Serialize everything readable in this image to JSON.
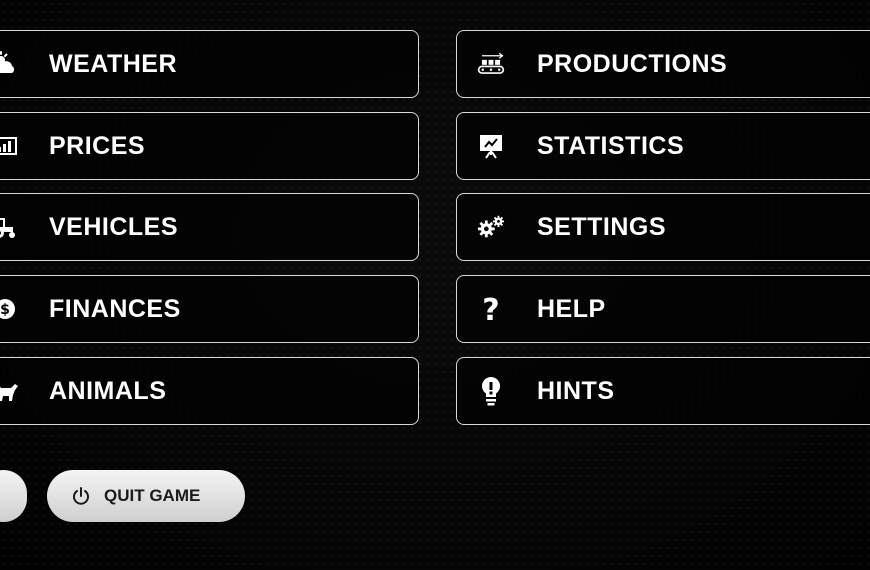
{
  "menu": {
    "left": [
      {
        "label": "WEATHER",
        "icon": "weather-icon"
      },
      {
        "label": "PRICES",
        "icon": "prices-icon"
      },
      {
        "label": "VEHICLES",
        "icon": "tractor-icon"
      },
      {
        "label": "FINANCES",
        "icon": "dollar-coin-icon"
      },
      {
        "label": "ANIMALS",
        "icon": "cow-icon"
      }
    ],
    "right": [
      {
        "label": "PRODUCTIONS",
        "icon": "conveyor-icon"
      },
      {
        "label": "STATISTICS",
        "icon": "presentation-board-icon"
      },
      {
        "label": "SETTINGS",
        "icon": "gears-icon"
      },
      {
        "label": "HELP",
        "icon": "question-mark-icon"
      },
      {
        "label": "HINTS",
        "icon": "lightbulb-icon"
      }
    ]
  },
  "bottom": {
    "quit_label": "QUIT GAME",
    "quit_icon": "power-icon"
  },
  "colors": {
    "background": "#050505",
    "button_border": "#d9d9d9",
    "text": "#ffffff",
    "pill_bg": "#e6e6e6",
    "pill_text": "#1a1a1a"
  }
}
